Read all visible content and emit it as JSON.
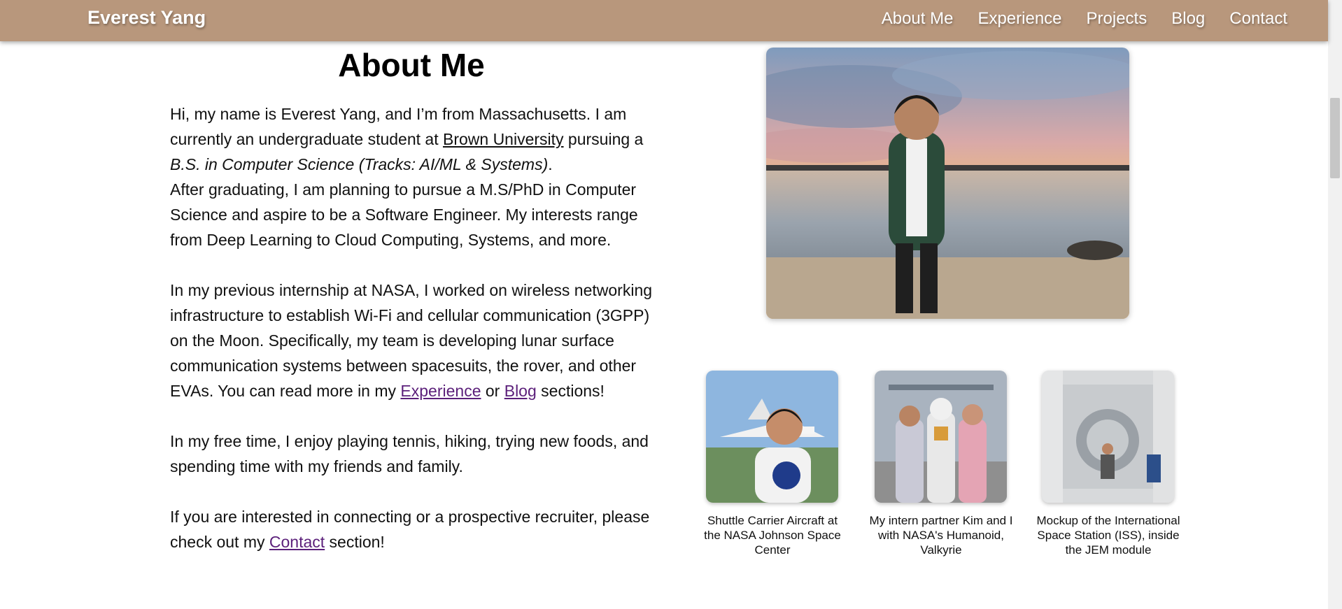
{
  "nav": {
    "brand": "Everest Yang",
    "links": [
      "About Me",
      "Experience",
      "Projects",
      "Blog",
      "Contact"
    ]
  },
  "about": {
    "title": "About Me",
    "p1_a": "Hi, my name is Everest Yang, and I’m from Massachusetts. I am currently an undergraduate student at ",
    "p1_link": "Brown University",
    "p1_b": " pursuing a ",
    "p1_degree": "B.S. in Computer Science (Tracks: AI/ML & Systems)",
    "p1_c": ".",
    "p1_d": "After graduating, I am planning to pursue a M.S/PhD in Computer Science and aspire to be a Software Engineer. My interests range from Deep Learning to Cloud Computing, Systems, and more.",
    "p2_a": "In my previous internship at NASA, I worked on wireless networking infrastructure to establish Wi-Fi and cellular communication (3GPP) on the Moon. Specifically, my team is developing lunar surface communication systems between spacesuits, the rover, and other EVAs. You can read more in my ",
    "p2_link1": "Experience",
    "p2_b": " or ",
    "p2_link2": "Blog",
    "p2_c": " sections!",
    "p3": "In my free time, I enjoy playing tennis, hiking, trying new foods, and spending time with my friends and family.",
    "p4_a": "If you are interested in connecting or a prospective recruiter, please check out my ",
    "p4_link": "Contact",
    "p4_b": " section!"
  },
  "gallery": {
    "captions": [
      "Shuttle Carrier Aircraft at the NASA Johnson Space Center",
      "My intern partner Kim and I with NASA's Humanoid, Valkyrie",
      "Mockup of the International Space Station (ISS), inside the JEM module"
    ]
  },
  "colors": {
    "navbar": "#b8977c",
    "link_visited": "#5b1f7a"
  }
}
